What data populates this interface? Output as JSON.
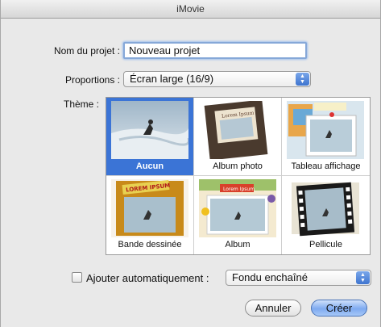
{
  "window": {
    "title": "iMovie"
  },
  "form": {
    "name_label": "Nom du projet :",
    "name_value": "Nouveau projet",
    "proportions_label": "Proportions :",
    "proportions_value": "Écran large (16/9)",
    "theme_label": "Thème :"
  },
  "themes": [
    {
      "label": "Aucun",
      "selected": true,
      "icon": "surfer-photo-icon"
    },
    {
      "label": "Album photo",
      "selected": false,
      "icon": "photo-album-book-icon",
      "thumb_text": "Lorem Ipsum"
    },
    {
      "label": "Tableau affichage",
      "selected": false,
      "icon": "bulletin-board-icon"
    },
    {
      "label": "Bande dessinée",
      "selected": false,
      "icon": "comic-book-icon",
      "thumb_text": "LOREM IPSUM"
    },
    {
      "label": "Album",
      "selected": false,
      "icon": "scrapbook-album-icon",
      "thumb_text": "Lorem Ipsum"
    },
    {
      "label": "Pellicule",
      "selected": false,
      "icon": "film-strip-icon"
    }
  ],
  "transitions": {
    "checkbox_label": "Ajouter automatiquement :",
    "checked": false,
    "value": "Fondu enchaîné"
  },
  "buttons": {
    "cancel": "Annuler",
    "create": "Créer"
  },
  "colors": {
    "selection": "#3b74d6",
    "focus_ring": "#86a8d8",
    "default_button": "#7eaaf0"
  }
}
